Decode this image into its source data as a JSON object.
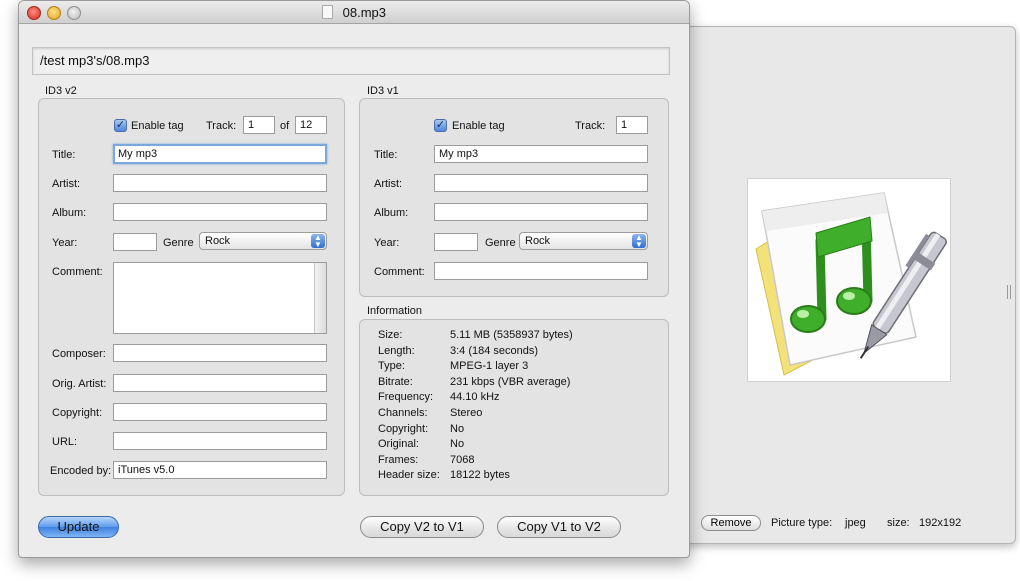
{
  "window": {
    "title": "08.mp3"
  },
  "path": "/test mp3's/08.mp3",
  "id3v2": {
    "section_label": "ID3 v2",
    "enable_tag_label": "Enable tag",
    "enable_tag_checked": true,
    "track_label": "Track:",
    "track_value": "1",
    "of_label": "of",
    "track_total": "12",
    "title_label": "Title:",
    "title_value": "My mp3",
    "artist_label": "Artist:",
    "artist_value": "",
    "album_label": "Album:",
    "album_value": "",
    "year_label": "Year:",
    "year_value": "",
    "genre_label": "Genre",
    "genre_value": "Rock",
    "comment_label": "Comment:",
    "composer_label": "Composer:",
    "composer_value": "",
    "orig_artist_label": "Orig. Artist:",
    "orig_artist_value": "",
    "copyright_label": "Copyright:",
    "copyright_value": "",
    "url_label": "URL:",
    "url_value": "",
    "encoded_by_label": "Encoded by:",
    "encoded_by_value": "iTunes v5.0"
  },
  "id3v1": {
    "section_label": "ID3 v1",
    "enable_tag_label": "Enable tag",
    "enable_tag_checked": true,
    "track_label": "Track:",
    "track_value": "1",
    "title_label": "Title:",
    "title_value": "My mp3",
    "artist_label": "Artist:",
    "artist_value": "",
    "album_label": "Album:",
    "album_value": "",
    "year_label": "Year:",
    "year_value": "",
    "genre_label": "Genre",
    "genre_value": "Rock",
    "comment_label": "Comment:",
    "comment_value": ""
  },
  "information": {
    "section_label": "Information",
    "rows": [
      {
        "key": "Size:",
        "value": "5.11 MB (5358937 bytes)"
      },
      {
        "key": "Length:",
        "value": "3:4 (184 seconds)"
      },
      {
        "key": "Type:",
        "value": "MPEG-1 layer 3"
      },
      {
        "key": "Bitrate:",
        "value": "231 kbps (VBR average)"
      },
      {
        "key": "Frequency:",
        "value": "44.10 kHz"
      },
      {
        "key": "Channels:",
        "value": "Stereo"
      },
      {
        "key": "Copyright:",
        "value": "No"
      },
      {
        "key": "Original:",
        "value": "No"
      },
      {
        "key": "Frames:",
        "value": "7068"
      },
      {
        "key": "Header size:",
        "value": "18122 bytes"
      }
    ]
  },
  "buttons": {
    "update": "Update",
    "copy_v2_to_v1": "Copy V2 to V1",
    "copy_v1_to_v2": "Copy V1 to V2"
  },
  "drawer": {
    "remove": "Remove",
    "picture_type_label": "Picture type:",
    "picture_type_value": "jpeg",
    "size_label": "size:",
    "size_value": "192x192"
  },
  "colors": {
    "note_green": "#3fae2a",
    "accent_blue": "#3e82e0",
    "window_bg": "#ececec"
  }
}
